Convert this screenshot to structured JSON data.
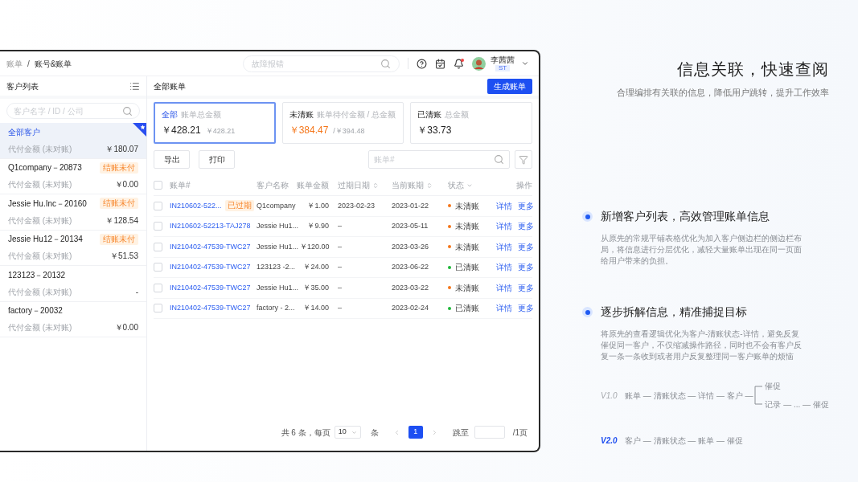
{
  "header": {
    "breadcrumb": [
      "账单",
      "账号&账单"
    ],
    "separator": "/",
    "search_placeholder": "故障报错",
    "notification": true,
    "user": {
      "name": "李茜茜",
      "badge": "ST"
    }
  },
  "sidebar": {
    "title": "客户列表",
    "search_placeholder": "客户名字 / ID / 公司",
    "customers": [
      {
        "name": "全部客户",
        "label": "代付金额 (未对账)",
        "amount": "￥180.07",
        "selected": true
      },
      {
        "name": "Q1company－20873",
        "tag": "结账未付",
        "label": "代付金额 (未对账)",
        "amount": "￥0.00",
        "selected": false
      },
      {
        "name": "Jessie Hu.Inc－20160",
        "tag": "结账未付",
        "label": "代付金额 (未对账)",
        "amount": "￥128.54",
        "selected": false
      },
      {
        "name": "Jessie Hu12－20134",
        "tag": "结账未付",
        "label": "代付金额 (未对账)",
        "amount": "￥51.53",
        "selected": false
      },
      {
        "name": "123123－20132",
        "label": "代付金额 (未对账)",
        "amount": "-",
        "selected": false
      },
      {
        "name": "factory－20032",
        "label": "代付金额 (未对账)",
        "amount": "￥0.00",
        "selected": false
      }
    ]
  },
  "main": {
    "title": "全部账单",
    "create_button": "生成账单",
    "cards": [
      {
        "title": "全部",
        "subtitle": "账单总金额",
        "value": "￥428.21",
        "secondary": "￥428.21",
        "selected": true,
        "alert": false
      },
      {
        "title": "未清账",
        "subtitle": "账单待付金额 / 总金额",
        "value": "￥384.47",
        "secondary": "/￥394.48",
        "selected": false,
        "alert": true
      },
      {
        "title": "已清账",
        "subtitle": "总金额",
        "value": "￥33.73",
        "selected": false,
        "alert": false
      }
    ],
    "toolbar_buttons": [
      "导出",
      "打印"
    ],
    "search_placeholder": "账单#",
    "table": {
      "select_all_checked": false,
      "columns": [
        {
          "label": "账单#"
        },
        {
          "label": "客户名称"
        },
        {
          "label": "账单金额"
        },
        {
          "label": "过期日期",
          "sortable": true
        },
        {
          "label": "当前账期",
          "sortable": true
        },
        {
          "label": "状态",
          "filterable": true
        },
        {
          "label": "操作"
        }
      ],
      "rows": [
        {
          "checked": false,
          "bill": "IN210602-522...",
          "tag": "已过期",
          "customer": "Q1company",
          "amount": "￥1.00",
          "due": "2023-02-23",
          "period": "2023-01-22",
          "status": "未清账",
          "color": "#f5761a",
          "actions": [
            "详情",
            "更多"
          ]
        },
        {
          "checked": false,
          "bill": "IN210602-52213-TAJ278",
          "customer": "Jessie Hu1...",
          "amount": "￥9.90",
          "due": "–",
          "period": "2023-05-11",
          "status": "未清账",
          "color": "#f5761a",
          "actions": [
            "详情",
            "更多"
          ]
        },
        {
          "checked": false,
          "bill": "IN210402-47539-TWC27",
          "customer": "Jessie Hu1...",
          "amount": "￥120.00",
          "due": "–",
          "period": "2023-03-26",
          "status": "未清账",
          "color": "#f5761a",
          "actions": [
            "详情",
            "更多"
          ]
        },
        {
          "checked": false,
          "bill": "IN210402-47539-TWC27",
          "customer": "123123 -2...",
          "amount": "￥24.00",
          "due": "–",
          "period": "2023-06-22",
          "status": "已清账",
          "color": "#1fb83a",
          "actions": [
            "详情",
            "更多"
          ]
        },
        {
          "checked": false,
          "bill": "IN210402-47539-TWC27",
          "customer": "Jessie Hu1...",
          "amount": "￥35.00",
          "due": "–",
          "period": "2023-03-22",
          "status": "未清账",
          "color": "#f5761a",
          "actions": [
            "详情",
            "更多"
          ]
        },
        {
          "checked": false,
          "bill": "IN210402-47539-TWC27",
          "customer": "factory - 2...",
          "amount": "￥14.00",
          "due": "–",
          "period": "2023-02-24",
          "status": "已清账",
          "color": "#1fb83a",
          "actions": [
            "详情",
            "更多"
          ]
        }
      ]
    },
    "pagination": {
      "total": "共 6 条，每页",
      "page_size": "10",
      "unit": "条",
      "pages": [
        {
          "label": "1",
          "selected": true
        }
      ],
      "jump": "跳至",
      "page_count": "/1页"
    }
  },
  "slide": {
    "title": "信息关联，快速查阅",
    "subtitle": "合理编排有关联的信息，降低用户跳转，提升工作效率",
    "features": [
      {
        "title": "新增客户列表，高效管理账单信息",
        "text": "从原先的常规平铺表格优化为加入客户侧边栏的侧边栏布局，将信息进行分层优化，减轻大量账单出现在同一页面给用户带来的负担。"
      },
      {
        "title": "逐步拆解信息，精准捕捉目标",
        "text": "将原先的查看逻辑优化为客户-清账状态-详情，避免反复催促同一客户，不仅缩减操作路径，同时也不会有客户反复一条一条收到或者用户反复整理同一客户账单的烦恼"
      }
    ],
    "versions": [
      {
        "label": "V1.0",
        "highlight": false,
        "chain": "账单 — 清账状态 — 详情 — 客户 —",
        "branches": [
          "催促",
          "记录 — ... — 催促"
        ]
      },
      {
        "label": "V2.0",
        "highlight": true,
        "chain": "客户 — 清账状态 — 账单 — 催促"
      }
    ]
  }
}
